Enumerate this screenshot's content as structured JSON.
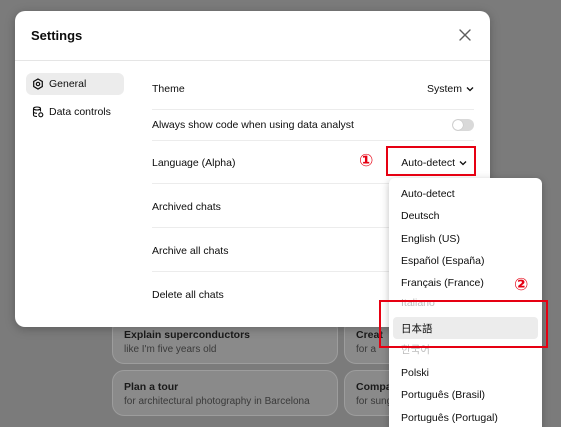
{
  "background_cards": [
    {
      "title": "Explain superconductors",
      "subtitle": "like I'm five years old"
    },
    {
      "title": "Creat",
      "subtitle": "for a"
    },
    {
      "title": "Plan a tour",
      "subtitle": "for architectural photography in Barcelona"
    },
    {
      "title": "Compa",
      "subtitle": "for sung"
    }
  ],
  "modal": {
    "title": "Settings",
    "close_icon": "close-icon",
    "sidebar": [
      {
        "label": "General",
        "icon": "gear-icon",
        "active": true
      },
      {
        "label": "Data controls",
        "icon": "database-icon",
        "active": false
      }
    ],
    "rows": {
      "theme": {
        "label": "Theme",
        "value": "System"
      },
      "code": {
        "label": "Always show code when using data analyst",
        "toggle_on": false
      },
      "language": {
        "label": "Language (Alpha)",
        "value": "Auto-detect"
      },
      "archived": {
        "label": "Archived chats"
      },
      "archive_all": {
        "label": "Archive all chats"
      },
      "delete_all": {
        "label": "Delete all chats"
      }
    }
  },
  "language_menu": {
    "options": [
      "Auto-detect",
      "Deutsch",
      "English (US)",
      "Español (España)",
      "Français (France)",
      "Italiano",
      "日本語",
      "한국어",
      "Polski",
      "Português (Brasil)",
      "Português (Portugal)"
    ],
    "highlighted": "日本語"
  },
  "annotations": {
    "marker_1": "①",
    "marker_2": "②",
    "color": "#e60012"
  }
}
